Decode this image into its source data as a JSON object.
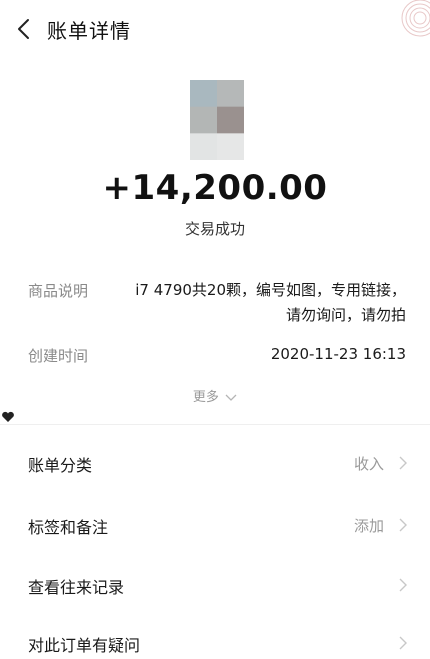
{
  "header": {
    "title": "账单详情",
    "back_icon": "chevron-left-icon"
  },
  "hero": {
    "amount": "+14,200.00",
    "status": "交易成功",
    "avatar_colors": [
      "#a9b8bf",
      "#b5b8b8",
      "#b3b6b5",
      "#9a918f",
      "#e2e4e4",
      "#e6e7e7"
    ]
  },
  "details": {
    "product": {
      "label": "商品说明",
      "value_line1": "i7 4790共20颗，编号如图，专用链接，",
      "value_line2": "请勿询问，请勿拍"
    },
    "created": {
      "label": "创建时间",
      "value": "2020-11-23 16:13"
    },
    "more_label": "更多"
  },
  "menu": [
    {
      "label": "账单分类",
      "value": "收入"
    },
    {
      "label": "标签和备注",
      "value": "添加"
    },
    {
      "label": "查看往来记录",
      "value": ""
    },
    {
      "label": "对此订单有疑问",
      "value": ""
    }
  ],
  "colors": {
    "text_primary": "#1a1a1a",
    "text_secondary": "#8a8a8a",
    "chevron": "#c8c8c8",
    "divider": "#efefef"
  }
}
